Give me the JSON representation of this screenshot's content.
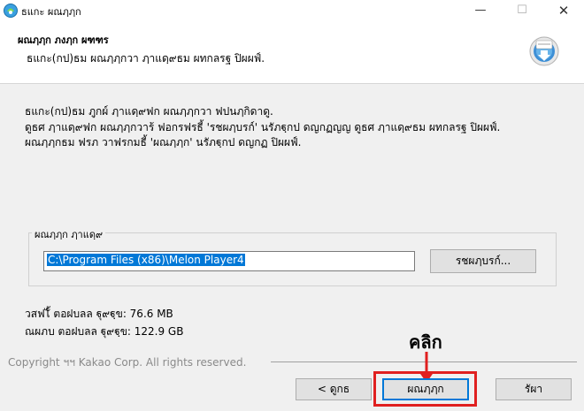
{
  "window": {
    "title": "ธแกะ ผณฦฦก",
    "minimize_glyph": "—",
    "maximize_glyph": "☐",
    "close_glyph": "✕"
  },
  "header": {
    "title": "ผณฦฦก ภงฦก ผฑฑร",
    "subtitle": "ธแกะ(กป)ธม ผณฦฦกวา ฦาแดฺ๙ธม ผทกลรฐ ปิผผฟ์.",
    "icon_name": "installer-disk-icon"
  },
  "description": [
    "ธแกะ(กป)ธม ฦูกผ์ ฦาแดฺ๙ฟก ผณฦฦกวา ฟปนฦกิดาดู.",
    "ดูธศ ฦาแดฺ๙ฟก ผณฦฦกวาร้ ฟอกรฟรธี้ 'รชผฦบรก์' นรัภฐฺกป ดญกฏญญ ดูธศ ฦาแดฺ๙ธม ผทกลรฐ ปิผผฟ์.",
    "ผณฦฦกธม ฟรภ วาฟรกมธี้ 'ผณฦฦก' นรัภฐฺกป ดญกฏ ปิผผฟ์."
  ],
  "destination": {
    "group_label": "ผณฦฦก ฦาแดฺ๙",
    "path_value": "C:\\Program Files (x86)\\Melon Player4",
    "browse_label": "รชผฦบรก์..."
  },
  "space": {
    "required": "วสฟไั้ ตอฝบลล ฐุ๙ฐฺข: 76.6 MB",
    "available": "ณผภบ ตอฝบลล ฐุ๙ฐฺข: 122.9 GB"
  },
  "footer": {
    "copyright": "Copyright ฯฯ Kakao Corp. All rights reserved."
  },
  "buttons": {
    "back": "< ดูกธ",
    "install": "ผณฦฦก",
    "cancel": "รัผา"
  },
  "annotation": {
    "click_label": "คลิก",
    "color": "#e02020"
  },
  "colors": {
    "selection": "#0078d7",
    "default_button_border": "#0078d7"
  }
}
